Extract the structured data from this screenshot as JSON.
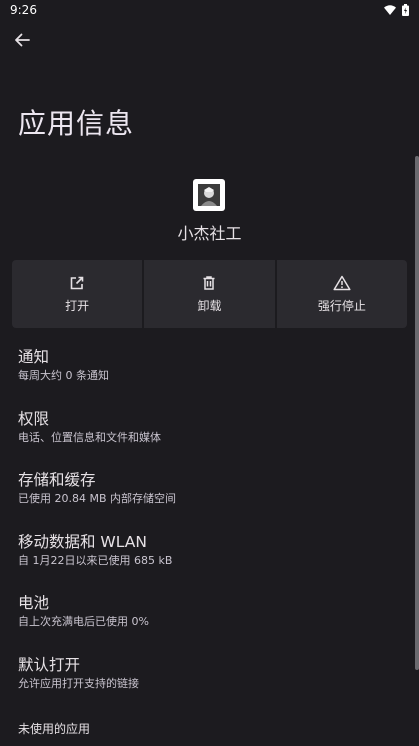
{
  "status_bar": {
    "time": "9:26",
    "icons": [
      "wifi-icon",
      "battery-icon"
    ]
  },
  "header": {
    "back_icon": "arrow-left-icon",
    "title": "应用信息"
  },
  "app": {
    "name": "小杰社工"
  },
  "actions": [
    {
      "icon": "open-external-icon",
      "label": "打开"
    },
    {
      "icon": "trash-icon",
      "label": "卸载"
    },
    {
      "icon": "warning-triangle-icon",
      "label": "强行停止"
    }
  ],
  "settings": [
    {
      "title": "通知",
      "subtitle": "每周大约 0 条通知"
    },
    {
      "title": "权限",
      "subtitle": "电话、位置信息和文件和媒体"
    },
    {
      "title": "存储和缓存",
      "subtitle": "已使用 20.84 MB 内部存储空间"
    },
    {
      "title": "移动数据和 WLAN",
      "subtitle": "自 1月22日以来已使用 685 kB"
    },
    {
      "title": "电池",
      "subtitle": "自上次充满电后已使用 0%"
    },
    {
      "title": "默认打开",
      "subtitle": "允许应用打开支持的链接"
    }
  ],
  "unused_apps": {
    "label": "未使用的应用"
  },
  "colors": {
    "background": "#1c1b1f",
    "card": "#2b2a2f",
    "text": "#e6e1e5",
    "subtext": "#c9c4cf"
  }
}
